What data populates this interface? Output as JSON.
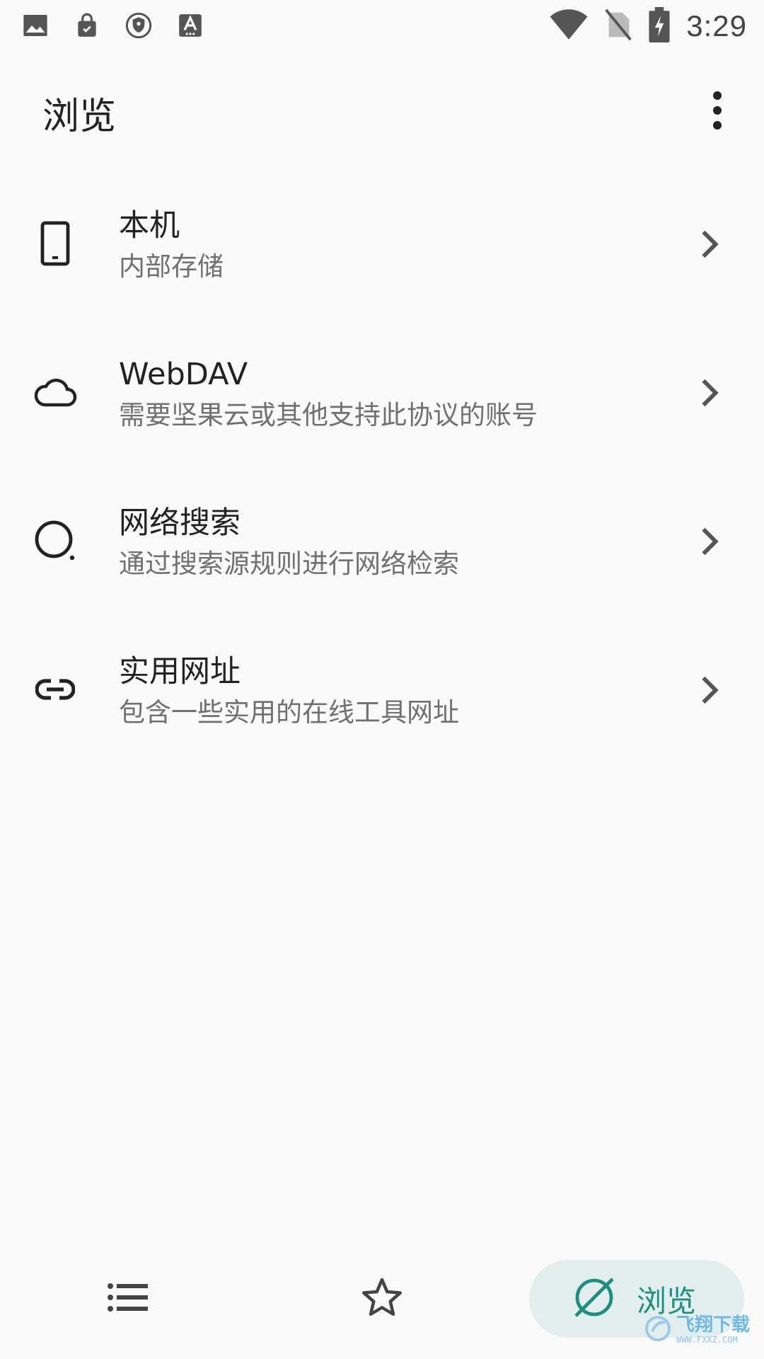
{
  "status_bar": {
    "time": "3:29",
    "left_icons": [
      "image-icon",
      "shopping-bag-icon",
      "shield-icon",
      "font-icon"
    ],
    "right_icons": [
      "wifi-icon",
      "no-sim-icon",
      "battery-charging-icon"
    ]
  },
  "app_bar": {
    "title": "浏览",
    "more_icon": "more-vert-icon"
  },
  "list": {
    "items": [
      {
        "id": "local",
        "icon": "phone-icon",
        "title": "本机",
        "subtitle": "内部存储"
      },
      {
        "id": "webdav",
        "icon": "cloud-icon",
        "title": "WebDAV",
        "subtitle": "需要坚果云或其他支持此协议的账号"
      },
      {
        "id": "web-search",
        "icon": "search-circle-icon",
        "title": "网络搜索",
        "subtitle": "通过搜索源规则进行网络检索"
      },
      {
        "id": "useful-urls",
        "icon": "link-icon",
        "title": "实用网址",
        "subtitle": "包含一些实用的在线工具网址"
      }
    ]
  },
  "bottom_nav": {
    "items": [
      {
        "id": "library",
        "icon": "list-icon",
        "label": ""
      },
      {
        "id": "favorites",
        "icon": "star-icon",
        "label": ""
      },
      {
        "id": "browse",
        "icon": "planet-icon",
        "label": "浏览",
        "selected": true
      }
    ]
  },
  "watermark": {
    "main": "飞翔下载",
    "sub": "WWW.FXXZ.COM"
  },
  "colors": {
    "background": "#fafafa",
    "accent": "#1e8e80",
    "accent_bg": "#e3efee",
    "text_primary": "#222222",
    "text_secondary": "#707070"
  }
}
